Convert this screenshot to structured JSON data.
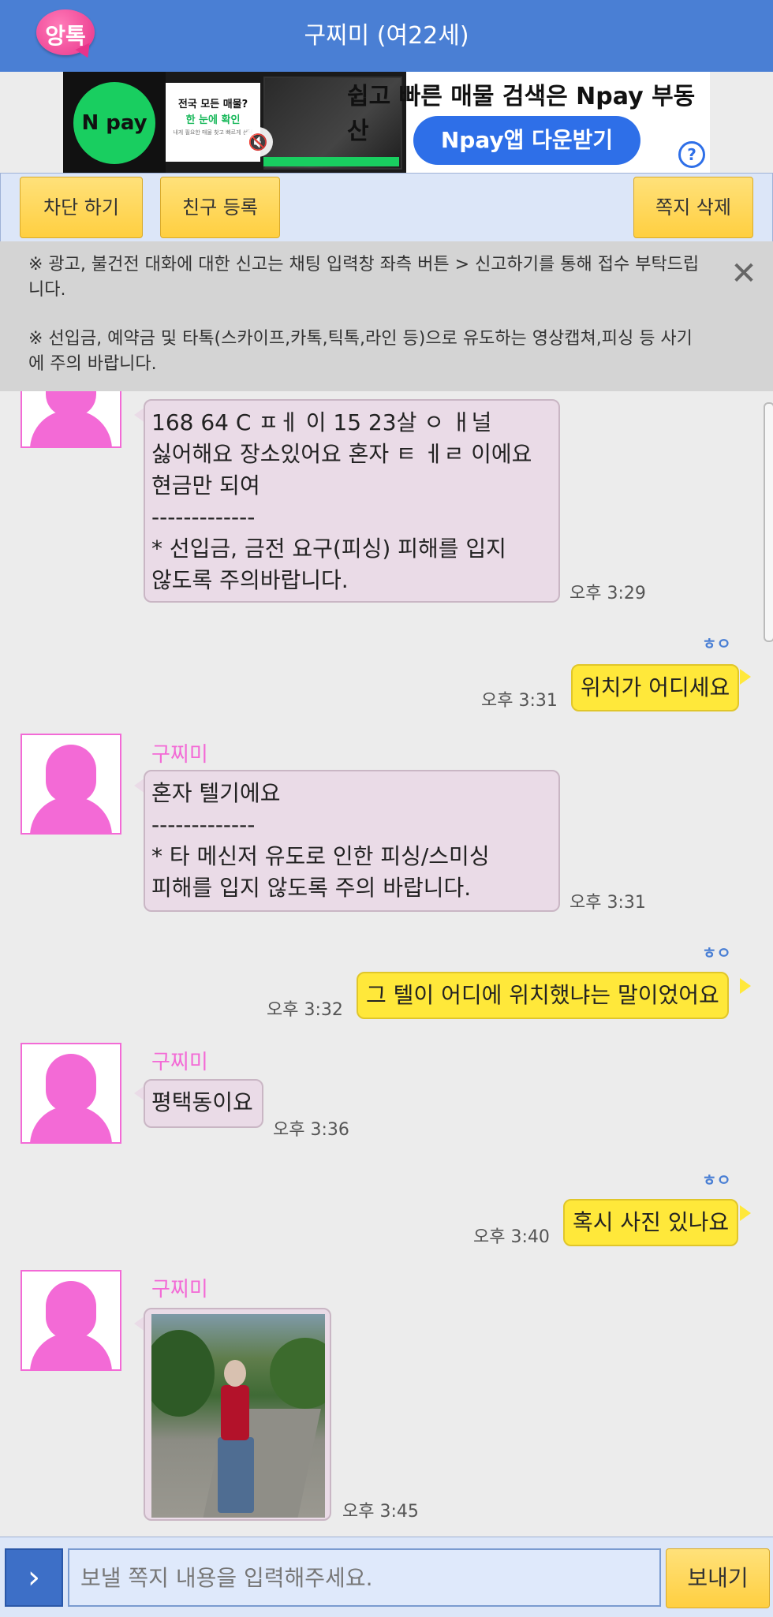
{
  "header": {
    "logo_text": "앙톡",
    "title": "구찌미 (여22세)"
  },
  "ad": {
    "brand": "N pay",
    "card_line1": "전국 모든 매물?",
    "card_line2": "한 눈에 확인",
    "card_line3": "내게 필요한 매물 찾고 빠르게 선택",
    "headline": "쉽고 빠른 매물 검색은 Npay 부동산",
    "cta": "Npay앱 다운받기",
    "help": "?"
  },
  "toolbar": {
    "block": "차단 하기",
    "add_friend": "친구 등록",
    "delete": "쪽지 삭제"
  },
  "notice": {
    "p1": "※ 광고, 불건전 대화에 대한 신고는 채팅 입력창 좌측 버튼 > 신고하기를 통해 접수 부탁드립니다.",
    "p2": "※ 선입금, 예약금 및 타톡(스카이프,카톡,틱톡,라인 등)으로 유도하는 영상캡쳐,피싱 등 사기에 주의 바랍니다.",
    "close": "✕"
  },
  "messages": {
    "m1": {
      "text": "168 64 C ㅍㅔ 이 15 23살 ㅇ ㅐ널\n싫어해요 장소있어요 혼자 ㅌ ㅔㄹ 이에요\n현금만 되여\n-------------\n* 선입금, 금전 요구(피싱) 피해를 입지\n않도록 주의바랍니다.",
      "time": "오후 3:29"
    },
    "m2": {
      "read": "ㅎㅇ",
      "text": "위치가 어디세요",
      "time": "오후 3:31"
    },
    "m3": {
      "name": "구찌미",
      "text": "혼자 텔기에요\n-------------\n* 타 메신저 유도로 인한 피싱/스미싱\n피해를 입지 않도록 주의 바랍니다.",
      "time": "오후 3:31"
    },
    "m4": {
      "read": "ㅎㅇ",
      "text": "그 텔이 어디에 위치했냐는 말이었어요",
      "time": "오후 3:32"
    },
    "m5": {
      "name": "구찌미",
      "text": "평택동이요",
      "time": "오후 3:36"
    },
    "m6": {
      "read": "ㅎㅇ",
      "text": "혹시 사진 있나요",
      "time": "오후 3:40"
    },
    "m7": {
      "name": "구찌미",
      "time": "오후 3:45"
    }
  },
  "input": {
    "menu_icon": "›",
    "placeholder": "보낼 쪽지 내용을 입력해주세요.",
    "send": "보내기"
  },
  "colors": {
    "header": "#4a7fd4",
    "accent_pink": "#f36ad6",
    "out_bubble": "#ffe83a",
    "in_bubble": "#eadbe7"
  }
}
